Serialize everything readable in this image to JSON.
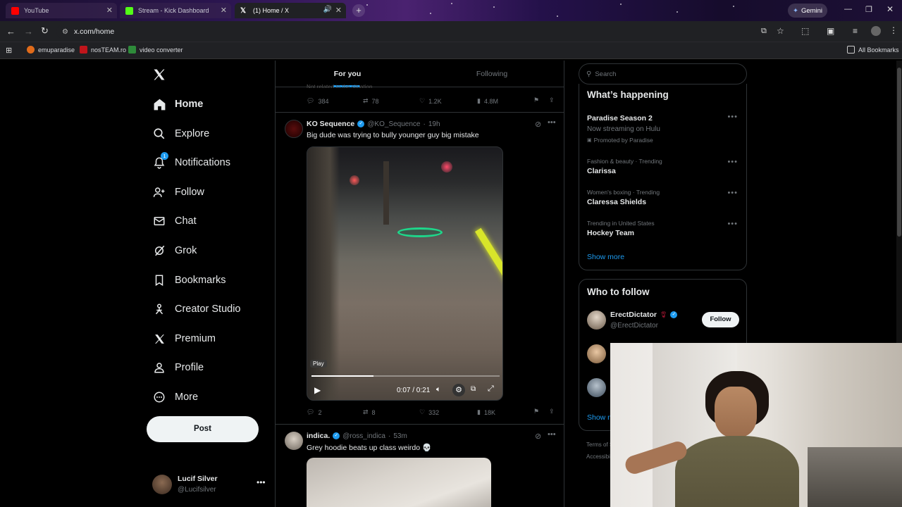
{
  "browser": {
    "tabs": [
      {
        "title": "YouTube",
        "active": false
      },
      {
        "title": "Stream - Kick Dashboard",
        "active": false
      },
      {
        "title": "(1) Home / X",
        "active": true
      }
    ],
    "gemini_label": "Gemini",
    "url": "x.com/home",
    "bookmarks": [
      "emuparadise",
      "nosTEAM.ro",
      "video converter"
    ],
    "all_bookmarks": "All Bookmarks"
  },
  "sidebar": {
    "items": [
      {
        "label": "Home",
        "icon": "home-icon"
      },
      {
        "label": "Explore",
        "icon": "search-icon"
      },
      {
        "label": "Notifications",
        "icon": "bell-icon",
        "badge": "1"
      },
      {
        "label": "Follow",
        "icon": "follow-icon"
      },
      {
        "label": "Chat",
        "icon": "mail-icon"
      },
      {
        "label": "Grok",
        "icon": "grok-icon"
      },
      {
        "label": "Bookmarks",
        "icon": "bookmark-icon"
      },
      {
        "label": "Creator Studio",
        "icon": "creator-icon"
      },
      {
        "label": "Premium",
        "icon": "x-icon"
      },
      {
        "label": "Profile",
        "icon": "profile-icon"
      },
      {
        "label": "More",
        "icon": "more-icon"
      }
    ],
    "post_button": "Post",
    "account": {
      "name": "Lucif Silver",
      "handle": "@Lucifsilver"
    }
  },
  "feed": {
    "tabs": [
      "For you",
      "Following"
    ],
    "prev_tweet_partial": "Not related to the situation",
    "prev_actions": {
      "replies": "384",
      "retweets": "78",
      "likes": "1.2K",
      "views": "4.8M"
    },
    "tweets": [
      {
        "name": "KO Sequence",
        "handle": "@KO_Sequence",
        "time": "19h",
        "text": "Big dude was trying to bully younger guy big mistake",
        "video": {
          "play_label": "Play",
          "time": "0:07 / 0:21",
          "progress": 0.33
        },
        "actions": {
          "replies": "2",
          "retweets": "8",
          "likes": "332",
          "views": "18K"
        }
      },
      {
        "name": "indica.",
        "handle": "@ross_indica",
        "time": "53m",
        "text": "Grey hoodie beats up class weirdo 💀"
      }
    ]
  },
  "right": {
    "search_placeholder": "Search",
    "whats_happening": {
      "title": "What’s happening",
      "trends": [
        {
          "meta": "",
          "title": "Paradise Season 2",
          "sub": "Now streaming on Hulu",
          "promo": "Promoted by Paradise"
        },
        {
          "meta": "Fashion & beauty · Trending",
          "title": "Clarissa"
        },
        {
          "meta": "Women's boxing · Trending",
          "title": "Claressa Shields"
        },
        {
          "meta": "Trending in United States",
          "title": "Hockey Team"
        }
      ],
      "show_more": "Show more"
    },
    "who_to_follow": {
      "title": "Who to follow",
      "users": [
        {
          "name": "ErectDictator",
          "handle": "@ErectDictator",
          "button": "Follow"
        }
      ],
      "show_more_partial": "Show m"
    },
    "footer_partial": [
      "Terms of S",
      "Accessibili"
    ]
  },
  "colors": {
    "accent": "#1d9bf0",
    "background": "#000000",
    "border": "#2f3336"
  }
}
